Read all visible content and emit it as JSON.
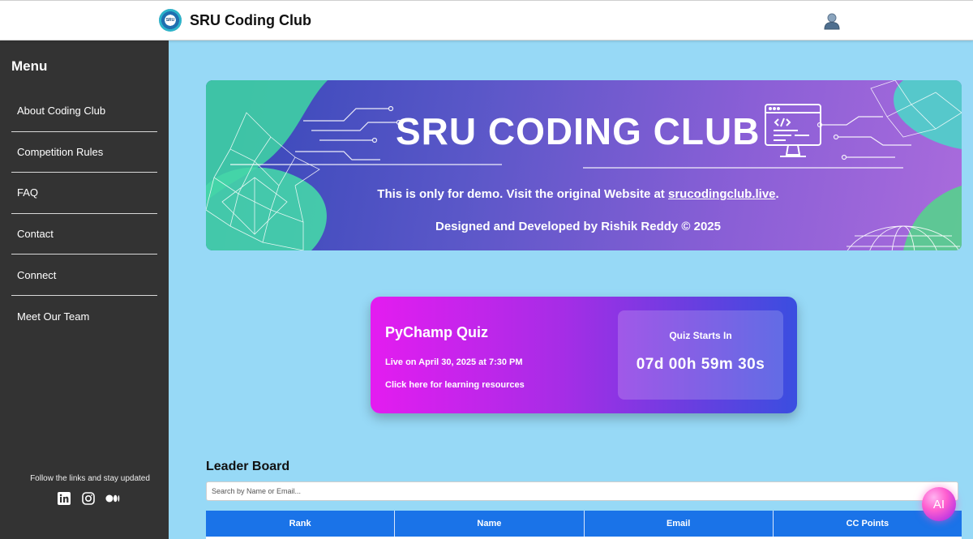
{
  "header": {
    "logo_text": "SRU",
    "title": "SRU Coding Club",
    "user_icon": "user-icon"
  },
  "sidebar": {
    "title": "Menu",
    "items": [
      {
        "label": "About Coding Club"
      },
      {
        "label": "Competition Rules"
      },
      {
        "label": "FAQ"
      },
      {
        "label": "Contact"
      },
      {
        "label": "Connect"
      },
      {
        "label": "Meet Our Team"
      }
    ],
    "follow_text": "Follow the links and stay updated",
    "social_icons": [
      "linkedin-icon",
      "instagram-icon",
      "medium-icon"
    ]
  },
  "banner": {
    "title": "SRU CODING CLUB",
    "demo_text": "This is only for demo. Visit the original Website at ",
    "demo_link": "srucodingclub.live",
    "demo_suffix": ".",
    "credit": "Designed and Developed by Rishik Reddy © 2025"
  },
  "quiz": {
    "title": "PyChamp Quiz",
    "live_text": "Live on April 30, 2025 at 7:30 PM",
    "resources_link": "Click here for learning resources",
    "countdown_label": "Quiz Starts In",
    "countdown_value": "07d 00h 59m 30s"
  },
  "leaderboard": {
    "title": "Leader Board",
    "search_placeholder": "Search by Name or Email...",
    "columns": [
      "Rank",
      "Name",
      "Email",
      "CC Points"
    ]
  },
  "ai_button": {
    "label": "AI"
  },
  "colors": {
    "sidebar": "#333333",
    "page_background": "#97d9f6",
    "table_header": "#1a73e8"
  }
}
